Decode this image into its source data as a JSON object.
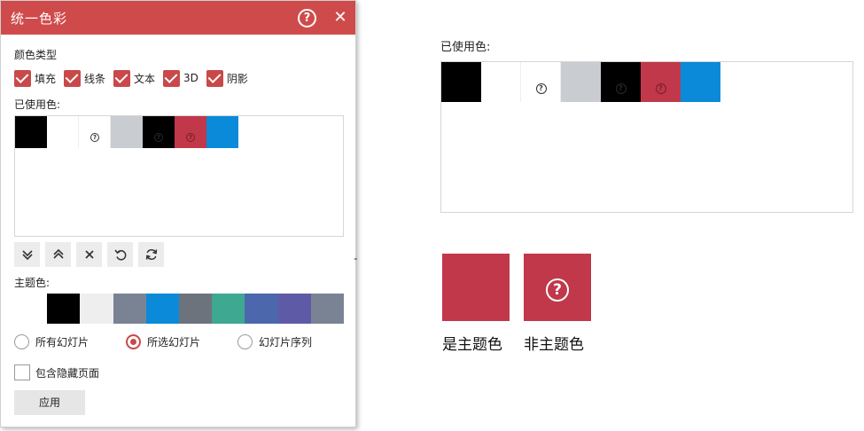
{
  "dialog": {
    "title": "统一色彩",
    "help_icon_glyph": "?",
    "close_icon_glyph": "✕",
    "color_type_label": "颜色类型",
    "color_types": [
      {
        "label": "填充",
        "checked": true
      },
      {
        "label": "线条",
        "checked": true
      },
      {
        "label": "文本",
        "checked": true
      },
      {
        "label": "3D",
        "checked": true
      },
      {
        "label": "阴影",
        "checked": true
      }
    ],
    "used_colors_label": "已使用色:",
    "used_colors": [
      {
        "color": "#000000",
        "marker": ""
      },
      {
        "color": "#ffffff",
        "marker": ""
      },
      {
        "color": "#ffffff",
        "marker": "?"
      },
      {
        "color": "#c9ccd1",
        "marker": ""
      },
      {
        "color": "#000000",
        "marker": "?"
      },
      {
        "color": "#c0384a",
        "marker": "?"
      },
      {
        "color": "#0a8ad8",
        "marker": ""
      }
    ],
    "toolbar_icons": [
      "move-bottom-icon",
      "move-top-icon",
      "delete-icon",
      "undo-icon",
      "refresh-icon"
    ],
    "theme_colors_label": "主题色:",
    "theme_colors": [
      "#ffffff",
      "#000000",
      "#eeeeee",
      "#7a8394",
      "#0a8ad8",
      "#6c737c",
      "#3ea890",
      "#4d67ad",
      "#5f5aa6",
      "#7a8394"
    ],
    "scope_options": [
      {
        "label": "所有幻灯片",
        "selected": false
      },
      {
        "label": "所选幻灯片",
        "selected": true
      },
      {
        "label": "幻灯片序列",
        "selected": false
      }
    ],
    "include_hidden_label": "包含隐藏页面",
    "include_hidden_checked": false,
    "apply_label": "应用",
    "accent_color": "#cf4b4b"
  },
  "preview": {
    "used_colors_label": "已使用色:",
    "legend": [
      {
        "color": "#c0384a",
        "marker": "",
        "label": "是主题色"
      },
      {
        "color": "#c0384a",
        "marker": "?",
        "label": "非主题色"
      }
    ]
  }
}
